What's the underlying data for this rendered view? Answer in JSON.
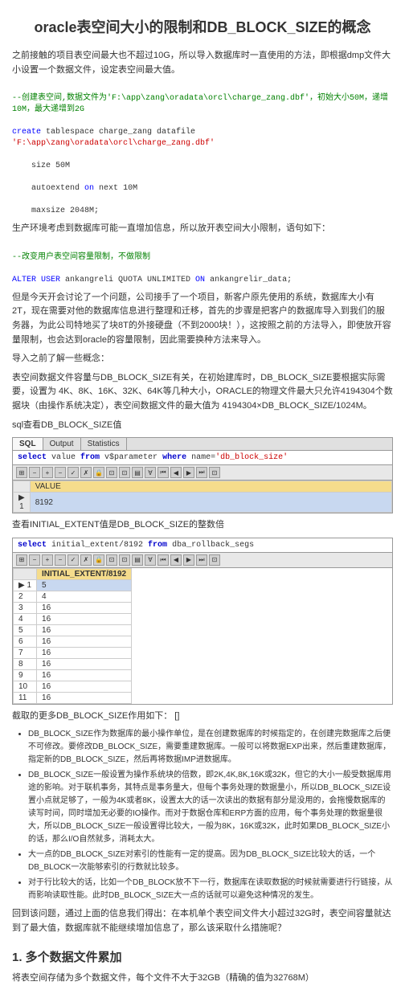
{
  "title": "oracle表空间大小的限制和DB_BLOCK_SIZE的概念",
  "intro": "之前接触的项目表空间最大也不超过10G，所以导入数据库时一直使用的方法，即根据dmp文件大小设置一个数据文件，设定表空间最大值。",
  "code1_comment": "--创建表空间,数据文件为'F:\\app\\zang\\oradata\\orcl\\charge_zang.dbf'，初始大小50M，递增10M，最大递增到2G",
  "code1_create": "create",
  "code1_mid": " tablespace charge_zang datafile ",
  "code1_path": "'F:\\app\\zang\\oradata\\orcl\\charge_zang.dbf'",
  "code1_size": "    size 50M",
  "code1_autoext1": "    autoextend ",
  "code1_on": "on",
  "code1_next": " next ",
  "code1_10m": "10M",
  "code1_maxsize": "    maxsize 2048M;",
  "p2": "生产环境考虑到数据库可能一直增加信息，所以放开表空间大小限制，语句如下：",
  "code2_comment": "--改变用户表空间容量限制，不做限制",
  "code2_alter": "ALTER USER",
  "code2_mid": " ankangreli QUOTA UNLIMITED ",
  "code2_on": "ON",
  "code2_rest": " ankangrelir_data;",
  "p3": "但是今天开会讨论了一个问题，公司接手了一个项目，新客户原先使用的系统，数据库大小有2T，现在需要对他的数据库信息进行整理和迁移，首先的步骤是把客户的数据库导入到我们的服务器，为此公司特地买了块8T的外接硬盘（不到2000块！），这按照之前的方法导入，即使放开容量限制，也会达到oracle的容量限制，因此需要换种方法来导入。",
  "p4": "导入之前了解一些概念：",
  "p5": "表空间数据文件容量与DB_BLOCK_SIZE有关，在初始建库时，DB_BLOCK_SIZE要根据实际需要，设置为 4K、8K、16K、32K、64K等几种大小，ORACLE的物理文件最大只允许4194304个数据块（由操作系统决定），表空间数据文件的最大值为 4194304×DB_BLOCK_SIZE/1024M。",
  "sql_heading": "sql查看DB_BLOCK_SIZE值",
  "sql1_tabs": {
    "main": "SQL",
    "output": "Output",
    "stats": "Statistics"
  },
  "sql1_query_select": "select",
  "sql1_query_mid": " value ",
  "sql1_query_from": "from",
  "sql1_query_tbl": " v$parameter ",
  "sql1_query_where": "where",
  "sql1_query_cond": " name=",
  "sql1_query_str": "'db_block_size'",
  "sql1_col": "VALUE",
  "sql1_val": "8192",
  "p6": "查看INITIAL_EXTENT值是DB_BLOCK_SIZE的整数倍",
  "sql2_query_select": "select",
  "sql2_query_mid": " initial_extent/8192 ",
  "sql2_query_from": "from",
  "sql2_query_rest": " dba_rollback_segs",
  "sql2_col": "INITIAL_EXTENT/8192",
  "sql2_rows": [
    "5",
    "4",
    "16",
    "16",
    "16",
    "16",
    "16",
    "16",
    "16",
    "16",
    "16"
  ],
  "p7": "截取的更多DB_BLOCK_SIZE作用如下：    []",
  "bullets": [
    "DB_BLOCK_SIZE作为数据库的最小操作单位，是在创建数据库的时候指定的，在创建完数据库之后便不可修改。要修改DB_BLOCK_SIZE，需要重建数据库。一般可以将数据EXP出来，然后重建数据库，指定新的DB_BLOCK_SIZE，然后再将数据IMP进数据库。",
    "DB_BLOCK_SIZE一般设置为操作系统块的倍数，即2K,4K,8K,16K或32K，但它的大小一般受数据库用途的影响。对于联机事务，其特点是事务量大，但每个事务处理的数据量小，所以DB_BLOCK_SIZE设置小点就足够了，一般为4K或者8K，设置太大的话一次读出的数据有部分是没用的，会拖慢数据库的读写时间，同时增加无必要的IO操作。而对于数据仓库和ERP方面的应用，每个事务处理的数据量很大，所以DB_BLOCK_SIZE一般设置得比较大，一般为8K，16K或32K，此时如果DB_BLOCK_SIZE小的话，那么I/O自然就多，消耗太大。",
    "大一点的DB_BLOCK_SIZE对索引的性能有一定的提高。因为DB_BLOCK_SIZE比较大的话，一个DB_BLOCK一次能够索引的行数就比较多。",
    "对于行比较大的话，比如一个DB_BLOCK放不下一行，数据库在读取数据的时候就需要进行行链接，从而影响读取性能。此时DB_BLOCK_SIZE大一点的话就可以避免这种情况的发生。"
  ],
  "p8": "回到该问题，通过上面的信息我们得出：在本机单个表空间文件大小超过32G时，表空间容量就达到了最大值，数据库就不能继续增加信息了，那么该采取什么措施呢？",
  "h2_1": "1. 多个数据文件累加",
  "p9": "将表空间存储为多个数据文件，每个文件不大于32GB（精确的值为32768M）"
}
